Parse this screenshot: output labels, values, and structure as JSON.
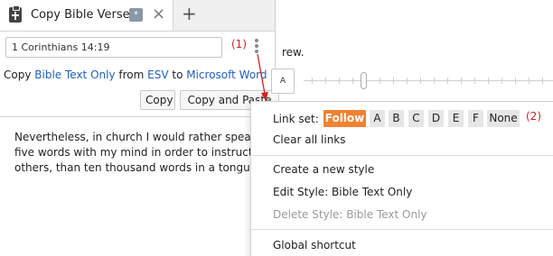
{
  "tab": {
    "title": "Copy Bible Verses",
    "badge": "*",
    "close_glyph": "×",
    "add_glyph": "+"
  },
  "reference_input": {
    "value": "1 Corinthians 14:19"
  },
  "copy_line": {
    "prefix": "Copy ",
    "style": "Bible Text Only",
    "from": " from ",
    "version": "ESV",
    "to": " to ",
    "target": "Microsoft Word"
  },
  "buttons": {
    "copy": "Copy",
    "copy_and_paste": "Copy and Paste"
  },
  "verse_text": "Nevertheless, in church I would rather speak five words with my mind in order to instruct others, than ten thousand words in a tongue.",
  "document": {
    "text_fragment": "rew.",
    "slider_box_label": "A"
  },
  "menu": {
    "link_set_label": "Link set:",
    "link_set_chips": [
      {
        "label": "Follow",
        "active": true
      },
      {
        "label": "A",
        "active": false
      },
      {
        "label": "B",
        "active": false
      },
      {
        "label": "C",
        "active": false
      },
      {
        "label": "D",
        "active": false
      },
      {
        "label": "E",
        "active": false
      },
      {
        "label": "F",
        "active": false
      },
      {
        "label": "None",
        "active": false
      }
    ],
    "clear_all_links": "Clear all links",
    "create_new_style": "Create a new style",
    "edit_style": "Edit Style: Bible Text Only",
    "delete_style": "Delete Style: Bible Text Only",
    "global_shortcut": "Global shortcut"
  },
  "annotations": {
    "label_1": "(1)",
    "label_2": "(2)"
  },
  "colors": {
    "accent": "#f08232",
    "link": "#1f5fbf",
    "annotation": "#d92020"
  },
  "icons": {
    "tab_icon": "bible-icon",
    "menu_icon": "more-vertical-icon"
  }
}
